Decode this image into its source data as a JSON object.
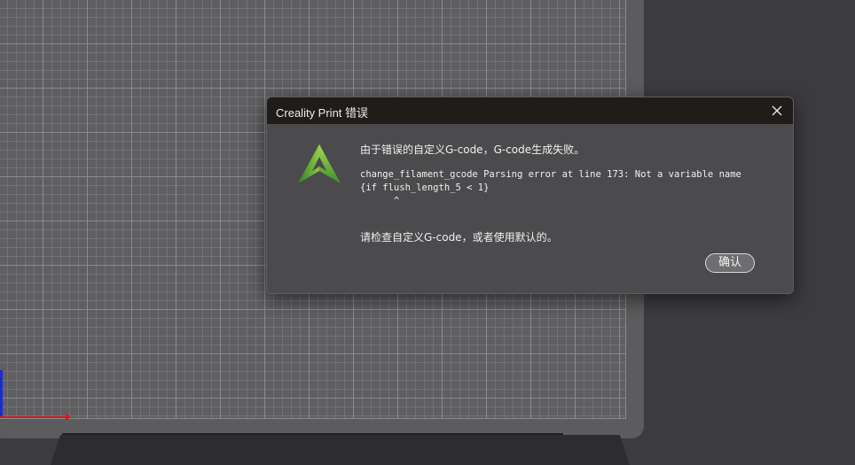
{
  "dialog": {
    "title": "Creality Print 错误",
    "message": "由于错误的自定义G-code，G-code生成失败。",
    "error_detail": "change_filament_gcode Parsing error at line 173: Not a variable name\n{if flush_length_5 < 1}\n      ^",
    "hint": "请检查自定义G-code，或者使用默认的。",
    "ok_label": "确认",
    "close_icon": "close-icon",
    "app_icon": "creality-logo-icon"
  },
  "colors": {
    "titlebar": "#201c1a",
    "dialog_body": "#4b4b4d",
    "logo_green": "#7ec23a",
    "axis_x": "#d01c1c",
    "axis_y": "#1c2bd0"
  }
}
